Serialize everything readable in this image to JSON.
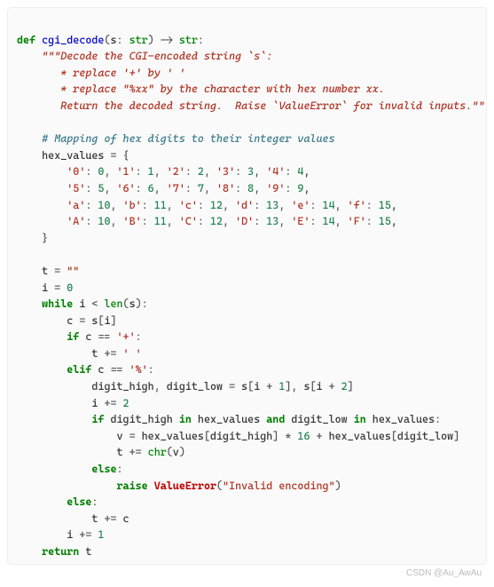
{
  "kw": {
    "def": "def",
    "while": "while",
    "if": "if",
    "elif": "elif",
    "else": "else",
    "return": "return",
    "in": "in",
    "and": "and",
    "raise": "raise"
  },
  "fn": {
    "name": "cgi_decode",
    "len": "len",
    "chr": "chr",
    "valueerror": "ValueError"
  },
  "type": {
    "str": "str"
  },
  "doc": {
    "l1": "\"\"\"Decode the CGI-encoded string `s`:",
    "l2": "   * replace '+' by ' '",
    "l3": "   * replace \"%xx\" by the character with hex number xx.",
    "l4": "   Return the decoded string.  Raise `ValueError` for invalid inputs.\"\"\""
  },
  "cmt": {
    "hex": "# Mapping of hex digits to their integer values"
  },
  "id": {
    "s": "s",
    "hex_values": "hex_values",
    "t": "t",
    "i": "i",
    "c": "c",
    "digit_high": "digit_high",
    "digit_low": "digit_low",
    "v": "v"
  },
  "str": {
    "k0": "'0'",
    "k1": "'1'",
    "k2": "'2'",
    "k3": "'3'",
    "k4": "'4'",
    "k5": "'5'",
    "k6": "'6'",
    "k7": "'7'",
    "k8": "'8'",
    "k9": "'9'",
    "ka": "'a'",
    "kb": "'b'",
    "kc": "'c'",
    "kd": "'d'",
    "ke": "'e'",
    "kf": "'f'",
    "kA": "'A'",
    "kB": "'B'",
    "kC": "'C'",
    "kD": "'D'",
    "kE": "'E'",
    "kF": "'F'",
    "empty": "\"\"",
    "plus": "'+'",
    "space": "' '",
    "pct": "'%'",
    "inv": "\"Invalid encoding\""
  },
  "num": {
    "n0": "0",
    "n1": "1",
    "n2": "2",
    "n3": "3",
    "n4": "4",
    "n5": "5",
    "n6": "6",
    "n7": "7",
    "n8": "8",
    "n9": "9",
    "n10": "10",
    "n11": "11",
    "n12": "12",
    "n13": "13",
    "n14": "14",
    "n15": "15",
    "n16": "16"
  },
  "op": {
    "lp": "(",
    "rp": ")",
    "arrow": " -> ",
    "colon": ":",
    "eq": " = ",
    "lb": "{",
    "rb": "}",
    "com": ", ",
    "lt": " < ",
    "sub": "[",
    "sube": "]",
    "eqeq": " == ",
    "pluseq": " += ",
    "plus": " + ",
    "mul": " * "
  },
  "watermark": "CSDN @Au_AwAu"
}
